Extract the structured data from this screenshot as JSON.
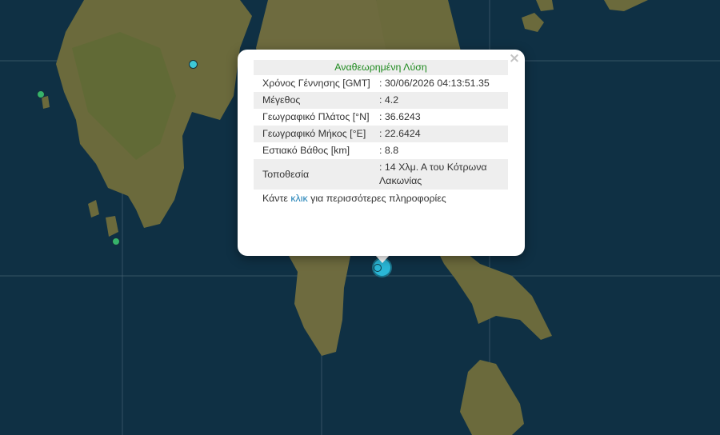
{
  "popup": {
    "close_label": "×",
    "title": "Αναθεωρημένη Λύση",
    "rows": [
      {
        "label": "Χρόνος Γέννησης [GMT]",
        "value": ": 30/06/2026 04:13:51.35"
      },
      {
        "label": "Μέγεθος",
        "value": ": 4.2"
      },
      {
        "label": "Γεωγραφικό Πλάτος [°N]",
        "value": ": 36.6243"
      },
      {
        "label": "Γεωγραφικό Μήκος [°E]",
        "value": ": 22.6424"
      },
      {
        "label": "Εστιακό Βάθος [km]",
        "value": ": 8.8"
      },
      {
        "label": "Τοποθεσία",
        "value": ": 14 Χλμ. Α του Κότρωνα Λακωνίας"
      }
    ],
    "more": {
      "prefix": "Κάντε",
      "link": "κλικ",
      "suffix": "για περισσότερες πληροφορίες"
    }
  },
  "colors": {
    "sea": "#0f3044",
    "land": "#6b6a3c",
    "title_green": "#1e8a1e",
    "link_blue": "#1d7fb5",
    "marker_selected": "#2ab6d6",
    "marker_cyan": "#3ec8d8",
    "marker_green": "#36b36a"
  }
}
